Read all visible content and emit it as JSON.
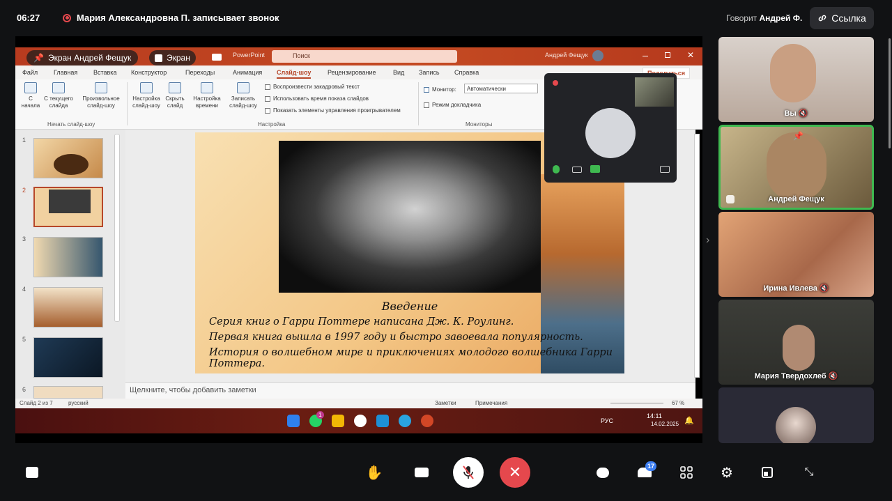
{
  "topbar": {
    "time": "06:27",
    "recording_text": "Мария Александровна П. записывает звонок",
    "speaking_prefix": "Говорит",
    "speaking_name": "Андрей Ф.",
    "link_label": "Ссылка"
  },
  "share": {
    "screen_chip": "Экран Андрей Фещук",
    "screen_chip2": "Экран",
    "app_name": "PowerPoint",
    "search_placeholder": "Поиск",
    "user_name": "Андрей Фещук",
    "share_button": "Поделиться",
    "tabs": [
      "Файл",
      "Главная",
      "Вставка",
      "Конструктор",
      "Переходы",
      "Анимация",
      "Слайд-шоу",
      "Рецензирование",
      "Вид",
      "Запись",
      "Справка"
    ],
    "active_tab": "Слайд-шоу",
    "ribbon": {
      "from_start": "С\nначала",
      "from_current": "С текущего\nслайда",
      "custom_show": "Произвольное\nслайд-шоу",
      "group_start": "Начать слайд-шоу",
      "setup": "Настройка\nслайд-шоу",
      "hide": "Скрыть\nслайд",
      "timing": "Настройка\nвремени",
      "record": "Записать\nслайд-шоу",
      "chk_narration": "Воспроизвести закадровый текст",
      "chk_timings": "Использовать время показа слайдов",
      "chk_controls": "Показать элементы управления проигрывателем",
      "group_setup": "Настройка",
      "monitor_label": "Монитор:",
      "monitor_value": "Автоматически",
      "presenter_view": "Режим докладчика",
      "group_monitors": "Мониторы"
    },
    "thumb_numbers": [
      "1",
      "2",
      "3",
      "4",
      "5",
      "6"
    ],
    "slide": {
      "heading": "Введение",
      "line1": "Серия книг о Гарри Поттере написана Дж. К. Роулинг.",
      "line2": "Первая книга вышла в 1997 году и быстро завоевала популярность.",
      "line3": "История о волшебном мире и приключениях молодого волшебника Гарри Поттера."
    },
    "notes_placeholder": "Щелкните, чтобы добавить заметки",
    "status": {
      "slide_counter": "Слайд 2 из 7",
      "language": "русский",
      "notes": "Заметки",
      "comments": "Примечания",
      "zoom": "67 %"
    },
    "taskbar": {
      "lang": "РУС",
      "time": "14:11",
      "date": "14.02.2025",
      "whatsapp_badge": "1"
    }
  },
  "participants": [
    {
      "name": "Вы"
    },
    {
      "name": "Андрей Фещук"
    },
    {
      "name": "Ирина Ивлева"
    },
    {
      "name": "Мария Твердохлеб"
    },
    {
      "name": ""
    }
  ],
  "controls": {
    "participants_badge": "17"
  },
  "colors": {
    "background": "#111214",
    "accent_red": "#e5484d",
    "active_speaker_border": "#3fb950",
    "powerpoint_red": "#b7472a"
  }
}
